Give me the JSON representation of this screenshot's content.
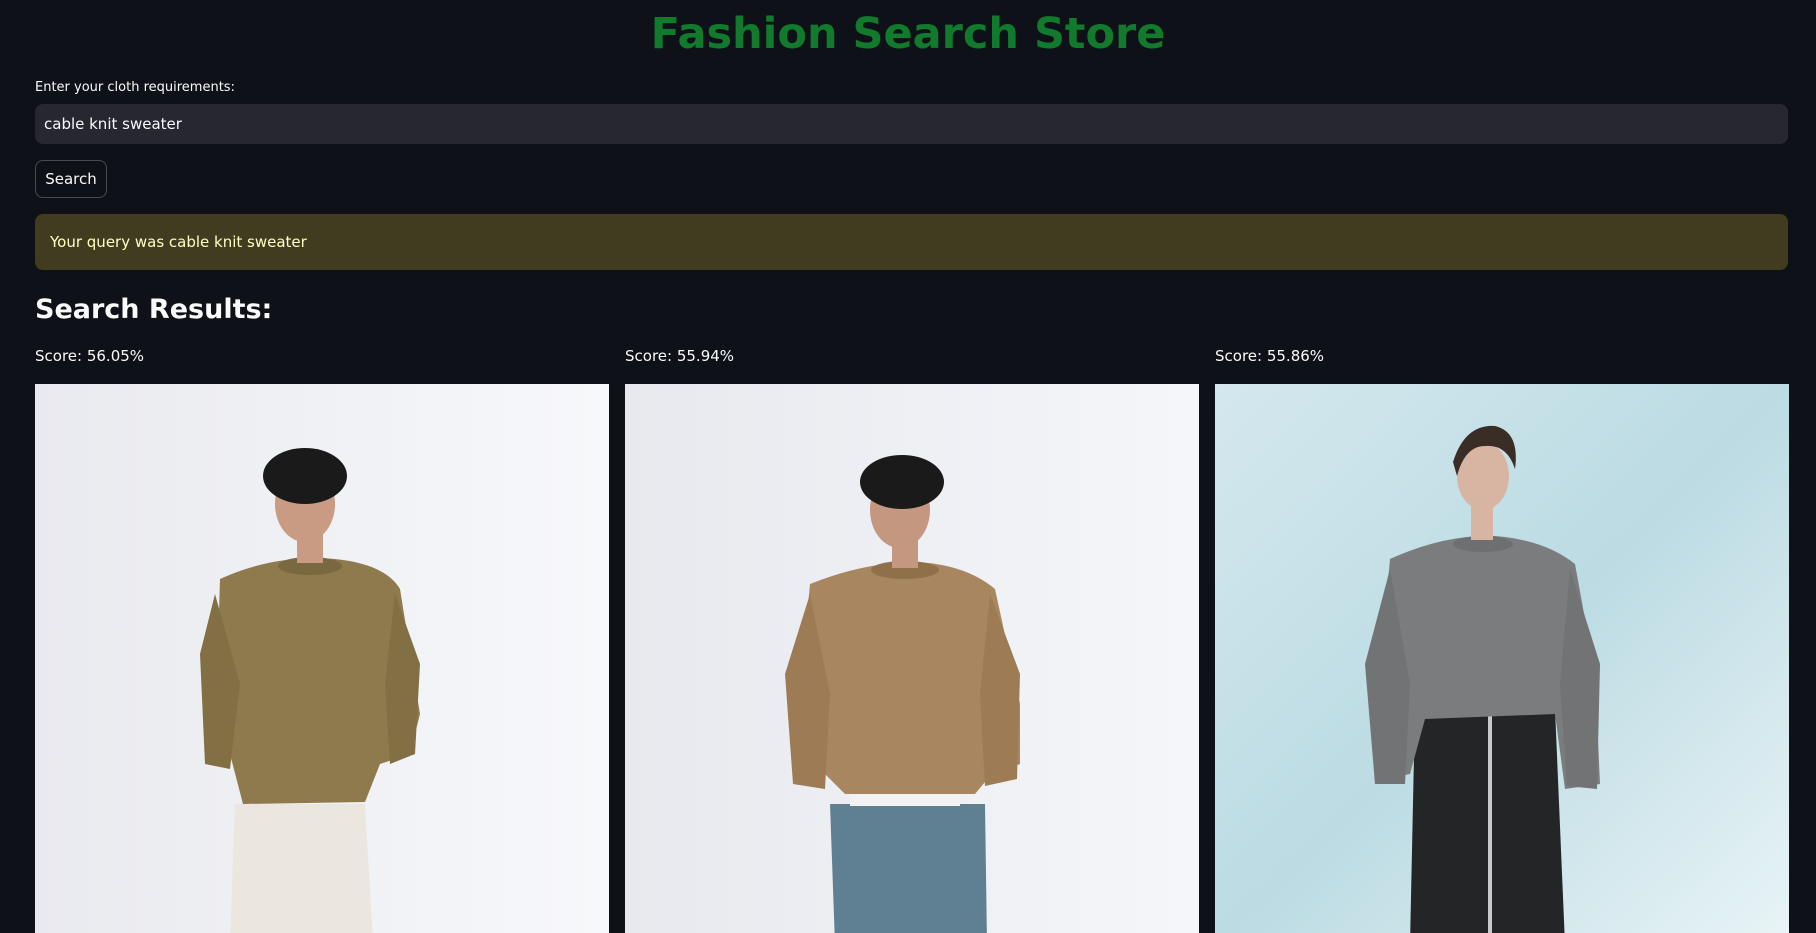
{
  "header": {
    "title": "Fashion Search Store"
  },
  "search": {
    "label": "Enter your cloth requirements:",
    "value": "cable knit sweater",
    "button_label": "Search"
  },
  "alert": {
    "message": "Your query was cable knit sweater"
  },
  "results": {
    "heading": "Search Results:",
    "items": [
      {
        "score": "Score: 56.05%",
        "icon": "man-olive-sweater-photo",
        "background": "#f2f3f7",
        "sweater_color": "#8e7a4c",
        "pants_color": "#ebe6de"
      },
      {
        "score": "Score: 55.94%",
        "icon": "man-camel-sweater-photo",
        "background": "#eef0f4",
        "sweater_color": "#a88760",
        "pants_color": "#5f7f93"
      },
      {
        "score": "Score: 55.86%",
        "icon": "woman-grey-sweater-photo",
        "background": "#dcedf1",
        "sweater_color": "#7b7c7d",
        "pants_color": "#242526"
      }
    ]
  },
  "colors": {
    "page_background": "#0e1117",
    "title_green": "#117a2c",
    "alert_background": "#413c20",
    "alert_text": "#ffffc2",
    "input_background": "#262730"
  }
}
